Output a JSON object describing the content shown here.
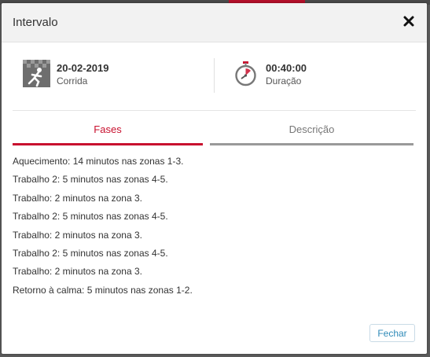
{
  "modal": {
    "title": "Intervalo",
    "close_icon": "close-icon"
  },
  "info": {
    "date": "20-02-2019",
    "activity": "Corrida",
    "activity_icon": "running-finish-flag-icon",
    "duration": "00:40:00",
    "duration_label": "Duração",
    "duration_icon": "stopwatch-icon"
  },
  "tabs": [
    {
      "label": "Fases",
      "active": true
    },
    {
      "label": "Descrição",
      "active": false
    }
  ],
  "phases": [
    "Aquecimento: 14 minutos nas zonas 1-3.",
    "Trabalho 2: 5 minutos nas zonas 4-5.",
    "Trabalho: 2 minutos na zona 3.",
    "Trabalho 2: 5 minutos nas zonas 4-5.",
    "Trabalho: 2 minutos na zona 3.",
    "Trabalho 2: 5 minutos nas zonas 4-5.",
    "Trabalho: 2 minutos na zona 3.",
    "Retorno à calma: 5 minutos nas zonas 1-2."
  ],
  "footer": {
    "close_label": "Fechar"
  },
  "colors": {
    "accent": "#c8102e",
    "link": "#2f8ab8"
  }
}
